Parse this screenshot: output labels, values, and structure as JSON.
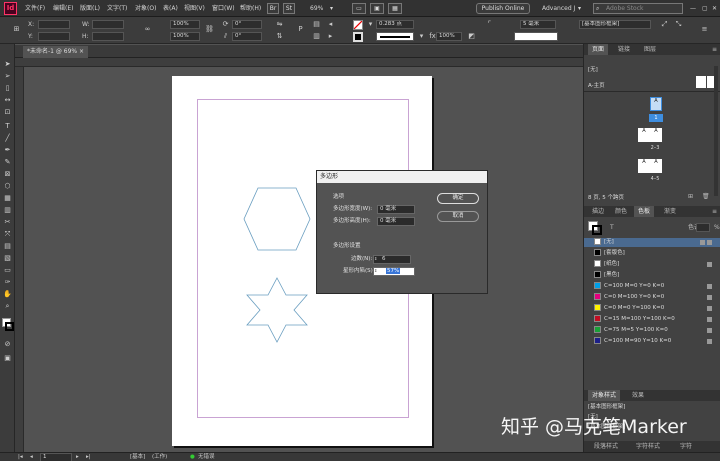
{
  "app": {
    "logo": "Id"
  },
  "menu": [
    "文件(F)",
    "编辑(E)",
    "版面(L)",
    "文字(T)",
    "对象(O)",
    "表(A)",
    "视图(V)",
    "窗口(W)",
    "帮助(H)"
  ],
  "topbar": {
    "br": "Br",
    "st": "St",
    "zoom": "69%",
    "publish": "Publish Online",
    "workspace": "Advanced J",
    "search_placeholder": "Adobe Stock"
  },
  "ctrl": {
    "x_label": "X:",
    "y_label": "Y:",
    "w_label": "W:",
    "h_label": "H:",
    "angle": "0°",
    "angle2": "0°",
    "pct1": "100%",
    "pct2": "100%",
    "stroke_weight": "0.283 点",
    "opacity": "100%",
    "size": "5 毫米",
    "style": "[基本图形框架]",
    "x_unit": "毫米",
    "p": "P"
  },
  "doc_tab": "*未命名-1 @ 69% ×",
  "dialog": {
    "title": "多边形",
    "section1": "选项",
    "width_label": "多边形宽度(W):",
    "width_val": "0 毫米",
    "height_label": "多边形高度(H):",
    "height_val": "0 毫米",
    "section2": "多边形设置",
    "sides_label": "边数(N):",
    "sides_val": "6",
    "star_label": "星形内陷(S):",
    "star_val": "57%",
    "ok": "确定",
    "cancel": "取消"
  },
  "pages_panel": {
    "tabs": [
      "页面",
      "链接",
      "图层"
    ],
    "none": "[无]",
    "master": "A-主页",
    "p1": "1",
    "p23": "2–3",
    "p45": "4–5",
    "pages_a": "A",
    "pages_count": "8 页, 5 个跨页"
  },
  "swatch_panel": {
    "tabs": [
      "描边",
      "颜色",
      "色板",
      "渐变"
    ],
    "tint_label": "色调",
    "pct": "%",
    "swatches": [
      {
        "name": "[无]",
        "color": "#ffffff"
      },
      {
        "name": "[套版色]",
        "color": "#000000"
      },
      {
        "name": "[纸色]",
        "color": "#ffffff"
      },
      {
        "name": "[黑色]",
        "color": "#000000"
      },
      {
        "name": "C=100 M=0 Y=0 K=0",
        "color": "#00a0e9"
      },
      {
        "name": "C=0 M=100 Y=0 K=0",
        "color": "#e4007f"
      },
      {
        "name": "C=0 M=0 Y=100 K=0",
        "color": "#fff100"
      },
      {
        "name": "C=15 M=100 Y=100 K=0",
        "color": "#c30d23"
      },
      {
        "name": "C=75 M=5 Y=100 K=0",
        "color": "#1aa037"
      },
      {
        "name": "C=100 M=90 Y=10 K=0",
        "color": "#1d2088"
      }
    ]
  },
  "obj_panel": {
    "tabs": [
      "对象样式",
      "效果"
    ],
    "items": [
      "[基本图形框架]",
      "[无]",
      "[基本图形框架]"
    ],
    "bottom": [
      "段落样式",
      "字符样式",
      "字符"
    ]
  },
  "status": {
    "page": "1",
    "master": "[基本]",
    "work": "(工作)",
    "errors": "无错误"
  },
  "watermark": "知乎 @马克笔Marker"
}
